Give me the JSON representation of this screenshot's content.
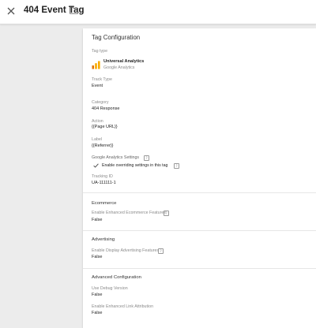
{
  "header": {
    "title": "404 Event Tag"
  },
  "config": {
    "card_title": "Tag Configuration",
    "tag_type_label": "Tag type",
    "tag_type_name": "Universal Analytics",
    "tag_type_vendor": "Google Analytics",
    "track_type_label": "Track Type",
    "track_type_value": "Event",
    "category_label": "Category",
    "category_value": "404 Response",
    "action_label": "Action",
    "action_value": "{{Page URL}}",
    "label_label": "Label",
    "label_value": "{{Referrer}}",
    "ga_settings_label": "Google Analytics Settings",
    "override_label": "Enable overriding settings in this tag",
    "override_checked": true,
    "tracking_id_label": "Tracking ID",
    "tracking_id_value": "UA-111111-1"
  },
  "ecommerce": {
    "title": "Ecommerce",
    "enhanced_label": "Enable Enhanced Ecommerce Features",
    "enhanced_value": "False"
  },
  "advertising": {
    "title": "Advertising",
    "display_label": "Enable Display Advertising Features",
    "display_value": "False"
  },
  "advanced": {
    "title": "Advanced Configuration",
    "debug_label": "Use Debug Version",
    "debug_value": "False",
    "link_label": "Enable Enhanced Link Attribution",
    "link_value": "False"
  },
  "icons": {
    "close": "close-icon",
    "folder": "folder-icon",
    "help": "help-icon",
    "check": "check-icon",
    "logo": "universal-analytics-logo"
  },
  "colors": {
    "logo_orange": "#f9ab00",
    "logo_dark": "#e37400",
    "background": "#ececec",
    "card": "#ffffff"
  }
}
